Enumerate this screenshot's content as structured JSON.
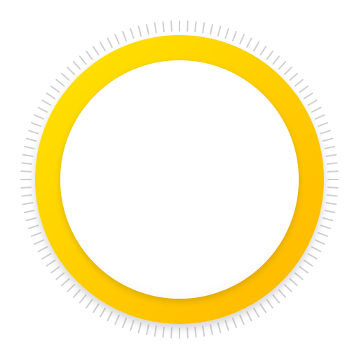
{
  "icon": {
    "name": "yellow-ring-dial-icon",
    "tick_count": 120
  },
  "colors": {
    "background": "#ffffff",
    "ring_start": "#ffe300",
    "ring_end": "#ffb800",
    "ticks": "#cfcfcf",
    "inner_face": "#ffffff",
    "shadow": "#000000"
  }
}
